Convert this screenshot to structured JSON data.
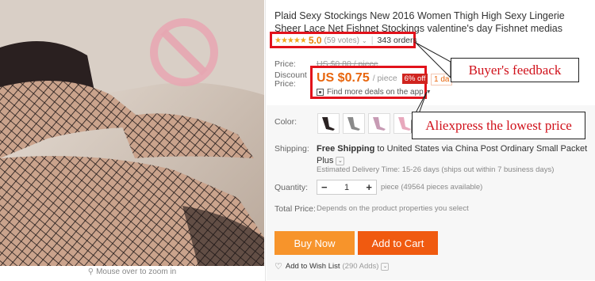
{
  "product": {
    "title": "Plaid Sexy Stockings New 2016 Women Thigh High Sexy Lingerie Sheer Lace Net Fishnet Stockings valentine's day Fishnet medias",
    "stars": "★★★★★",
    "rating": "5.0",
    "votes": "(59 votes)",
    "orders": "343 orders"
  },
  "pricing": {
    "price_label": "Price:",
    "original_price": "US $0.80 / piece",
    "discount_label_line1": "Discount",
    "discount_label_line2": "Price:",
    "discount_price": "US $0.75",
    "unit": "/ piece",
    "off_badge": "6% off",
    "days_left": "1 da",
    "app_deal_text": "Find more deals on the app"
  },
  "color": {
    "label": "Color:",
    "swatch_count": 5
  },
  "shipping": {
    "label": "Shipping:",
    "free_text": "Free Shipping",
    "rest_text": " to United States via China Post Ordinary Small Packet Plus",
    "estimate": "Estimated Delivery Time: 15-26 days (ships out within 7 business days)"
  },
  "quantity": {
    "label": "Quantity:",
    "value": "1",
    "minus": "−",
    "plus": "+",
    "available": "piece (49564 pieces available)"
  },
  "total": {
    "label": "Total Price:",
    "note": "Depends on the product properties you select"
  },
  "actions": {
    "buy_now": "Buy Now",
    "add_to_cart": "Add to Cart",
    "wish_list": "Add to Wish List",
    "wish_count": "(290 Adds)"
  },
  "image": {
    "zoom_hint": "Mouse over to zoom in"
  },
  "annotations": {
    "feedback": "Buyer's feedback",
    "lowest_price": "Aliexpress the lowest price",
    "highlight_color": "#e2121b"
  },
  "colors": {
    "accent_orange": "#f05a10",
    "buy_orange": "#f7942b",
    "price_orange": "#e8660e"
  }
}
